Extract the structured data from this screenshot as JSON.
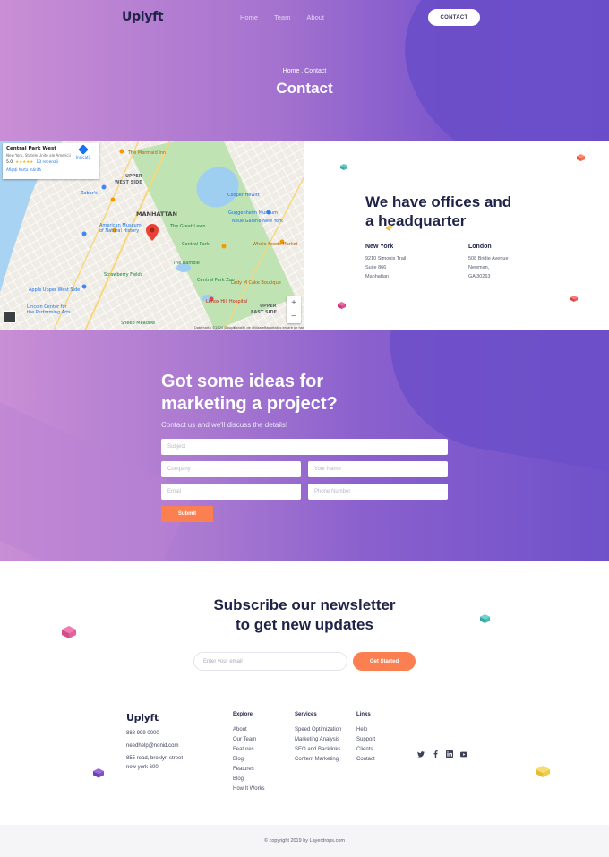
{
  "brand": {
    "logo": "Uplyft"
  },
  "header": {
    "nav": [
      "Home",
      "Team",
      "About"
    ],
    "cta": "CONTACT"
  },
  "hero": {
    "breadcrumb": "Home . Contact",
    "title": "Contact"
  },
  "map": {
    "place_name": "Central Park West",
    "place_address": "New York, Statele Unite ale Americii",
    "rating": "5.0",
    "stars": "★★★★★",
    "reviews": "13 recenzii",
    "directions": "Indicații",
    "larger_map": "Afișați harta mărită",
    "labels": [
      "UPPER WEST SIDE",
      "MANHATTAN",
      "UPPER EAST SIDE",
      "The Mermaid Inn",
      "Zabar's",
      "American Museum of Natural History",
      "Central Park",
      "The Great Lawn",
      "Cooper Hewitt",
      "Guggenheim Museum",
      "Neue Galerie New York",
      "The Ramble",
      "Central Park Zoo",
      "Apple Upper West Side",
      "Lincoln Center for the Performing Arts",
      "Whole Foods Market",
      "Lady M Cake Boutique",
      "Lenox Hill Hospital",
      "Sheep Meadow",
      "Strawberry Fields"
    ],
    "footer_text": [
      "Date hartă ©2020 Google",
      "Condiții de utilizare",
      "Raportați o eroare pe hartă"
    ],
    "zoom_in": "+",
    "zoom_out": "−"
  },
  "offices": {
    "title_line1": "We have offices and",
    "title_line2": "a headquarter",
    "locations": [
      {
        "city": "New York",
        "lines": [
          "9210 Simonis Trail",
          "Suite 866",
          "Manhattan"
        ]
      },
      {
        "city": "London",
        "lines": [
          "508 Bridie Avenue",
          "Newman,",
          "GA 30263"
        ]
      }
    ]
  },
  "ideas": {
    "title_line1": "Got some ideas for",
    "title_line2": "marketing a project?",
    "subtitle": "Contact us and we'll discuss the details!",
    "placeholders": {
      "subject": "Subject",
      "company": "Company",
      "name": "Your Name",
      "email": "Email",
      "phone": "Phone Number"
    },
    "submit": "Submit"
  },
  "newsletter": {
    "title_line1": "Subscribe our newsletter",
    "title_line2": "to get new updates",
    "placeholder": "Enter your email",
    "button": "Get Started"
  },
  "footer": {
    "phone": "888 999 0000",
    "email": "needhelp@nonid.com",
    "address_line1": "855 road, broklyn street",
    "address_line2": "new york 600",
    "columns": [
      {
        "heading": "Explore",
        "items": [
          "About",
          "Our Team",
          "Features",
          "Blog",
          "Features",
          "Blog",
          "How It Works"
        ]
      },
      {
        "heading": "Services",
        "items": [
          "Speed Optimization",
          "Marketing Analysis",
          "SEO and Backlinks",
          "Content Marketing"
        ]
      },
      {
        "heading": "Links",
        "items": [
          "Help",
          "Support",
          "Clients",
          "Contact"
        ]
      }
    ],
    "social_icons": [
      "twitter-icon",
      "facebook-icon",
      "linkedin-icon",
      "youtube-icon"
    ],
    "copyright": "© copyright 2019 by Layerdrops.com"
  },
  "colors": {
    "accent": "#fb7f51",
    "purple": "#6b4fca",
    "pink": "#c98ed5",
    "navy": "#1e2347"
  }
}
